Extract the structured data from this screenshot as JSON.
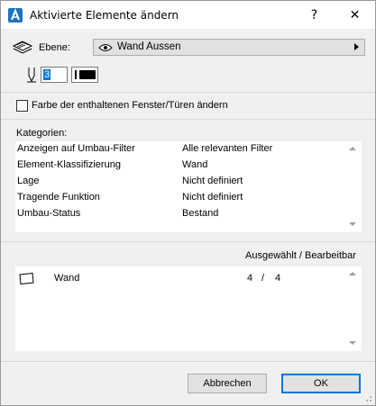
{
  "window": {
    "title": "Aktivierte Elemente ändern",
    "help_label": "?",
    "close_label": "✕"
  },
  "layer": {
    "label": "Ebene:",
    "value": "Wand Aussen"
  },
  "pen": {
    "value": "3"
  },
  "window_door_option": {
    "label": "Farbe der enthaltenen Fenster/Türen ändern",
    "checked": false
  },
  "categories": {
    "label": "Kategorien:",
    "rows": [
      {
        "key": "Anzeigen auf Umbau-Filter",
        "value": "Alle relevanten Filter"
      },
      {
        "key": "Element-Klassifizierung",
        "value": "Wand"
      },
      {
        "key": "Lage",
        "value": "Nicht definiert"
      },
      {
        "key": "Tragende Funktion",
        "value": "Nicht definiert"
      },
      {
        "key": "Umbau-Status",
        "value": "Bestand"
      }
    ]
  },
  "selection": {
    "header": "Ausgewählt / Bearbeitbar",
    "items": [
      {
        "name": "Wand",
        "selected": "4",
        "slash": "/",
        "editable": "4"
      }
    ]
  },
  "buttons": {
    "cancel": "Abbrechen",
    "ok": "OK"
  }
}
